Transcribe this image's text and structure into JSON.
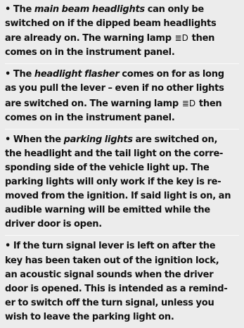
{
  "blocks": [
    {
      "bullet": "•",
      "before": "The ",
      "highlight": "main beam headlights",
      "l1": " can only be",
      "l2": "switched on if the dipped beam headlights",
      "l3a": "are already on. The warning lamp ",
      "icon": "≣D",
      "l3b": " then",
      "l4": "comes on in the instrument panel."
    },
    {
      "bullet": "•",
      "before": "The ",
      "highlight": "headlight flasher",
      "l1": " comes on for as long",
      "l2": "as you pull the lever – even if no other lights",
      "l3a": "are switched on. The warning lamp ",
      "icon": "≣D",
      "l3b": " then",
      "l4": "comes on in the instrument panel."
    },
    {
      "bullet": "•",
      "before": "When the ",
      "highlight": "parking lights",
      "l1": " are switched on,",
      "lines": [
        "the headlight and the tail light on the corre-",
        "sponding side of the vehicle light up. The",
        "parking lights will only work if the key is re-",
        "moved from the ignition. If said light is on, an",
        "audible warning will be emitted while the",
        "driver door is open."
      ]
    },
    {
      "bullet": "•",
      "lines": [
        "If the turn signal lever is left on after the",
        "key has been taken out of the ignition lock,",
        "an acoustic signal sounds when the driver",
        "door is opened. This is intended as a remind-",
        "er to switch off the turn signal, unless you",
        "wish to leave the parking light on."
      ]
    }
  ]
}
